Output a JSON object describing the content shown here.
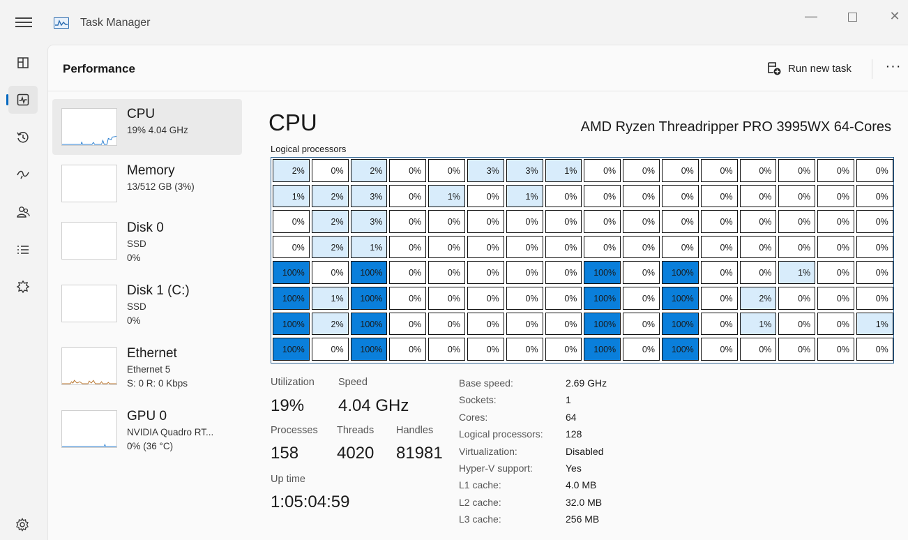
{
  "window": {
    "title": "Task Manager",
    "minimize": "—",
    "close": "✕"
  },
  "header": {
    "title": "Performance",
    "run_new_task": "Run new task",
    "more": "···"
  },
  "nav": [
    "processes-icon",
    "performance-icon",
    "app-history-icon",
    "startup-apps-icon",
    "users-icon",
    "details-icon",
    "services-icon",
    "settings-icon"
  ],
  "resources": [
    {
      "name": "CPU",
      "sub1": "19% 4.04 GHz",
      "sub2": "",
      "sub3": ""
    },
    {
      "name": "Memory",
      "sub1": "13/512 GB (3%)",
      "sub2": "",
      "sub3": ""
    },
    {
      "name": "Disk 0",
      "sub1": "SSD",
      "sub2": "0%",
      "sub3": ""
    },
    {
      "name": "Disk 1 (C:)",
      "sub1": "SSD",
      "sub2": "0%",
      "sub3": ""
    },
    {
      "name": "Ethernet",
      "sub1": "Ethernet 5",
      "sub2": "S: 0 R: 0 Kbps",
      "sub3": ""
    },
    {
      "name": "GPU 0",
      "sub1": "NVIDIA Quadro RT...",
      "sub2": "0% (36 °C)",
      "sub3": ""
    }
  ],
  "cpu": {
    "title": "CPU",
    "model": "AMD Ryzen Threadripper PRO 3995WX 64-Cores",
    "logical_label": "Logical processors",
    "grid": [
      [
        "2%",
        "0%",
        "2%",
        "0%",
        "0%",
        "3%",
        "3%",
        "1%",
        "0%",
        "0%",
        "0%",
        "0%",
        "0%",
        "0%",
        "0%",
        "0%"
      ],
      [
        "1%",
        "2%",
        "3%",
        "0%",
        "1%",
        "0%",
        "1%",
        "0%",
        "0%",
        "0%",
        "0%",
        "0%",
        "0%",
        "0%",
        "0%",
        "0%"
      ],
      [
        "0%",
        "2%",
        "3%",
        "0%",
        "0%",
        "0%",
        "0%",
        "0%",
        "0%",
        "0%",
        "0%",
        "0%",
        "0%",
        "0%",
        "0%",
        "0%"
      ],
      [
        "0%",
        "2%",
        "1%",
        "0%",
        "0%",
        "0%",
        "0%",
        "0%",
        "0%",
        "0%",
        "0%",
        "0%",
        "0%",
        "0%",
        "0%",
        "0%"
      ],
      [
        "100%",
        "0%",
        "100%",
        "0%",
        "0%",
        "0%",
        "0%",
        "0%",
        "100%",
        "0%",
        "100%",
        "0%",
        "0%",
        "1%",
        "0%",
        "0%"
      ],
      [
        "100%",
        "1%",
        "100%",
        "0%",
        "0%",
        "0%",
        "0%",
        "0%",
        "100%",
        "0%",
        "100%",
        "0%",
        "2%",
        "0%",
        "0%",
        "0%"
      ],
      [
        "100%",
        "2%",
        "100%",
        "0%",
        "0%",
        "0%",
        "0%",
        "0%",
        "100%",
        "0%",
        "100%",
        "0%",
        "1%",
        "0%",
        "0%",
        "1%"
      ],
      [
        "100%",
        "0%",
        "100%",
        "0%",
        "0%",
        "0%",
        "0%",
        "0%",
        "100%",
        "0%",
        "100%",
        "0%",
        "0%",
        "0%",
        "0%",
        "0%"
      ]
    ],
    "stats": {
      "utilization_label": "Utilization",
      "utilization": "19%",
      "speed_label": "Speed",
      "speed": "4.04 GHz",
      "processes_label": "Processes",
      "processes": "158",
      "threads_label": "Threads",
      "threads": "4020",
      "handles_label": "Handles",
      "handles": "81981",
      "uptime_label": "Up time",
      "uptime": "1:05:04:59"
    },
    "specs": [
      {
        "label": "Base speed:",
        "value": "2.69 GHz"
      },
      {
        "label": "Sockets:",
        "value": "1"
      },
      {
        "label": "Cores:",
        "value": "64"
      },
      {
        "label": "Logical processors:",
        "value": "128"
      },
      {
        "label": "Virtualization:",
        "value": "Disabled"
      },
      {
        "label": "Hyper-V support:",
        "value": "Yes"
      },
      {
        "label": "L1 cache:",
        "value": "4.0 MB"
      },
      {
        "label": "L2 cache:",
        "value": "32.0 MB"
      },
      {
        "label": "L3 cache:",
        "value": "256 MB"
      }
    ]
  },
  "colors": {
    "accent": "#0067c0",
    "cell_high": "#0a7fdb",
    "cell_low": "#d8ecfb",
    "graph": "#2b7fd0",
    "ethernet_graph": "#b8742c"
  }
}
